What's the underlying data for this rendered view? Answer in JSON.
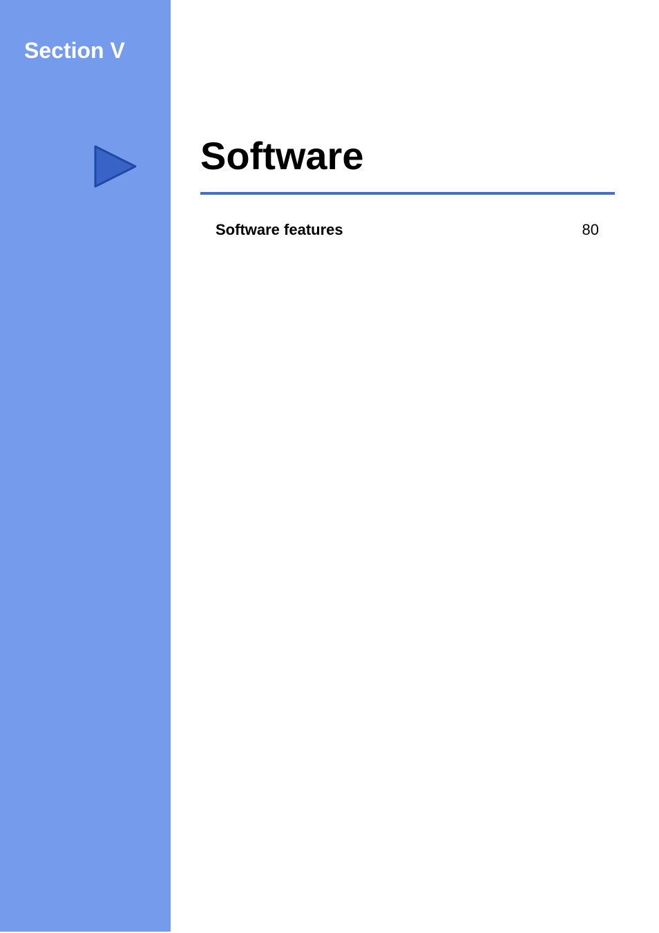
{
  "sidebar": {
    "section_label": "Section V"
  },
  "main": {
    "title": "Software",
    "toc": {
      "label": "Software features",
      "page": "80"
    }
  },
  "colors": {
    "sidebar_bg": "#759cec",
    "underline": "#4270c8",
    "triangle_stroke": "#1f4aa3",
    "triangle_fill": "#3a63c8"
  }
}
